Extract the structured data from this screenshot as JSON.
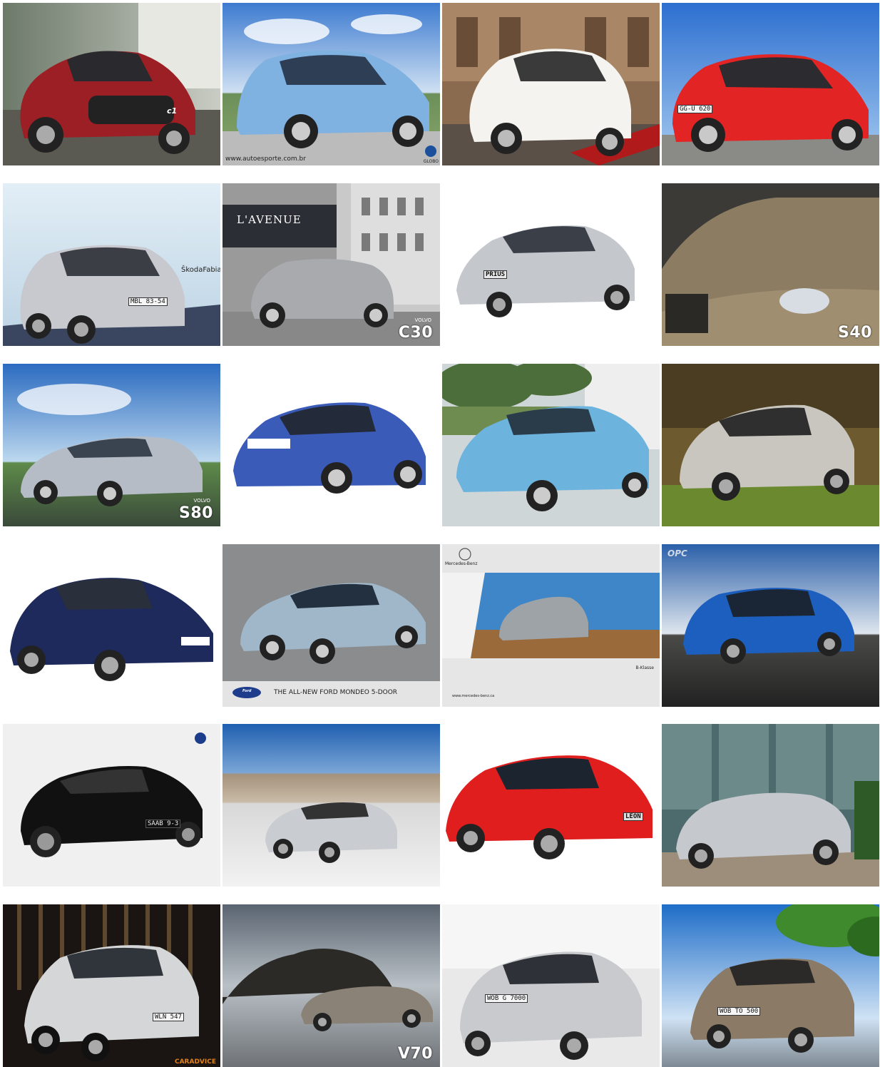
{
  "gallery": {
    "tiles": [
      {
        "badge": "c1"
      },
      {
        "watermark": "www.autoesporte.com.br",
        "logo": "GLOBO"
      },
      {},
      {
        "plate": "GG-U 620"
      },
      {
        "brand_text": "ŠkodaFabia",
        "plate": "MBL 83-54"
      },
      {
        "sign": "L'AVENUE",
        "model_small": "VOLVO",
        "model": "C30"
      },
      {
        "badge": "PRIUS"
      },
      {
        "model": "S40"
      },
      {
        "model_small": "VOLVO",
        "model": "S80"
      },
      {},
      {},
      {},
      {},
      {
        "caption": "THE ALL-NEW FORD MONDEO 5-DOOR",
        "logo": "Ford"
      },
      {
        "brand": "Mercedes-Benz",
        "model": "B-Klasse",
        "footer": "www.mercedes-benz.ca"
      },
      {
        "logo": "OPC"
      },
      {
        "badge": "SAAB 9-3"
      },
      {},
      {
        "badge": "LEON"
      },
      {},
      {
        "plate": "WLN 547",
        "watermark": "CARADVICE"
      },
      {
        "model": "V70"
      },
      {
        "plate": "WOB G 7000"
      },
      {
        "plate": "WOB TO 500"
      }
    ]
  }
}
